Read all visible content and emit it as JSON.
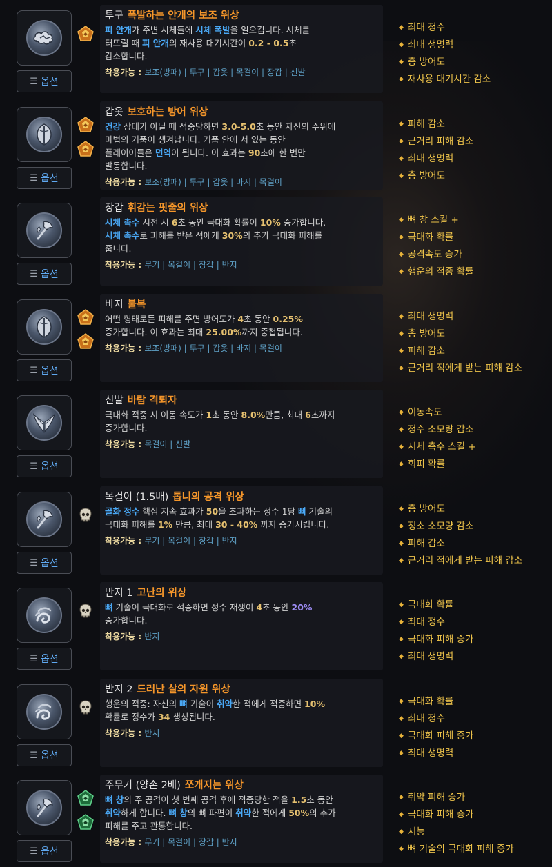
{
  "option_label": "옵션",
  "equip_label": "착용가능 :",
  "colors": {
    "aspect": "#f5962a",
    "keyword": "#4aa8f5",
    "number": "#e6c170",
    "stat": "#ecc24a",
    "option": "#5fa8f0"
  },
  "rows": [
    {
      "slot": "투구",
      "aspect": "폭발하는 안개의 보조 위상",
      "icon": "cloud-burst-icon",
      "badges": [
        "gold-pentagon-icon"
      ],
      "desc": [
        [
          {
            "k": "kw",
            "t": "피 안개"
          },
          {
            "t": "가 주변 시체들에 "
          },
          {
            "k": "kw",
            "t": "시체 폭발"
          },
          {
            "t": "을 일으킵니다. 시체를"
          }
        ],
        [
          {
            "t": "터뜨릴 때 "
          },
          {
            "k": "kw",
            "t": "피 안개"
          },
          {
            "t": "의 재사용 대기시간이 "
          },
          {
            "k": "num",
            "t": "0.2 - 0.5"
          },
          {
            "t": "초"
          }
        ],
        [
          {
            "t": "감소합니다."
          }
        ]
      ],
      "equip": "보조(방패) | 투구 | 갑옷 | 목걸이 | 장갑 | 신발",
      "stats": [
        "최대 정수",
        "최대 생명력",
        "총 방어도",
        "재사용 대기시간 감소"
      ]
    },
    {
      "slot": "갑옷",
      "aspect": "보호하는 방어 위상",
      "icon": "shield-icon",
      "badges": [
        "gold-pentagon-icon",
        "gold-pentagon-icon"
      ],
      "desc": [
        [
          {
            "k": "kw",
            "t": "건강"
          },
          {
            "t": " 상태가 아닐 때 적중당하면 "
          },
          {
            "k": "num",
            "t": "3.0-5.0"
          },
          {
            "t": "초 동안 자신의 주위에"
          }
        ],
        [
          {
            "t": "마법의 거품이 생겨납니다. 거품 안에 서 있는 동안"
          }
        ],
        [
          {
            "t": "플레이어들은 "
          },
          {
            "k": "kw",
            "t": "면역"
          },
          {
            "t": "이 됩니다. 이 효과는 "
          },
          {
            "k": "num",
            "t": "90"
          },
          {
            "t": "초에 한 번만"
          }
        ],
        [
          {
            "t": "발동합니다."
          }
        ]
      ],
      "equip": "보조(방패) | 투구 | 갑옷 | 바지 | 목걸이",
      "stats": [
        "피해 감소",
        "근거리 피해 감소",
        "최대 생명력",
        "총 방어도"
      ]
    },
    {
      "slot": "장갑",
      "aspect": "휘감는 핏줄의 위상",
      "icon": "axe-icon",
      "badges": [],
      "desc": [
        [
          {
            "k": "kw",
            "t": "시체 촉수"
          },
          {
            "t": " 시전 시 "
          },
          {
            "k": "num",
            "t": "6"
          },
          {
            "t": "초 동안 극대화 확률이 "
          },
          {
            "k": "num",
            "t": "10%"
          },
          {
            "t": " 증가합니다."
          }
        ],
        [
          {
            "k": "kw",
            "t": "시체 촉수"
          },
          {
            "t": "로 피해를 받은 적에게 "
          },
          {
            "k": "num",
            "t": "30%"
          },
          {
            "t": "의 추가 극대화 피해를"
          }
        ],
        [
          {
            "t": "줍니다."
          }
        ]
      ],
      "equip": "무기 | 목걸이 | 장갑 | 반지",
      "stats": [
        "뼈 창 스킬 +",
        "극대화 확률",
        "공격속도 증가",
        "행운의 적중 확률"
      ]
    },
    {
      "slot": "바지",
      "aspect": "불복",
      "icon": "shield-icon",
      "badges": [
        "gold-pentagon-icon",
        "gold-pentagon-icon"
      ],
      "desc": [
        [
          {
            "t": "어떤 형태로든 피해를 주면 방어도가 "
          },
          {
            "k": "num",
            "t": "4"
          },
          {
            "t": "초 동안 "
          },
          {
            "k": "num",
            "t": "0.25%"
          }
        ],
        [
          {
            "t": "증가합니다. 이 효과는 최대 "
          },
          {
            "k": "num",
            "t": "25.00%"
          },
          {
            "t": "까지 중첩됩니다."
          }
        ]
      ],
      "equip": "보조(방패) | 투구 | 갑옷 | 바지 | 목걸이",
      "stats": [
        "최대 생명력",
        "총 방어도",
        "피해 감소",
        "근거리 적에게 받는 피해 감소"
      ]
    },
    {
      "slot": "신발",
      "aspect": "바람 격퇴자",
      "icon": "wings-icon",
      "badges": [],
      "desc": [
        [
          {
            "t": "극대화 적중 시 이동 속도가 "
          },
          {
            "k": "num",
            "t": "1"
          },
          {
            "t": "초 동안 "
          },
          {
            "k": "num",
            "t": "8.0%"
          },
          {
            "t": "만큼, 최대 "
          },
          {
            "k": "num",
            "t": "6"
          },
          {
            "t": "초까지"
          }
        ],
        [
          {
            "t": "증가합니다."
          }
        ]
      ],
      "equip": "목걸이 | 신발",
      "stats": [
        "이동속도",
        "정수 소모량 감소",
        "시체 촉수 스킬 +",
        "회피 확률"
      ]
    },
    {
      "slot": "목걸이 (1.5배)",
      "aspect": "톱니의 공격 위상",
      "icon": "axe-icon",
      "badges": [
        "skull-icon"
      ],
      "desc": [
        [
          {
            "k": "kw",
            "t": "골화 정수"
          },
          {
            "t": " 핵심 지속 효과가 "
          },
          {
            "k": "num",
            "t": "50"
          },
          {
            "t": "을 초과하는 정수 1당 "
          },
          {
            "k": "kw",
            "t": "뼈"
          },
          {
            "t": " 기술의"
          }
        ],
        [
          {
            "t": "극대화 피해를 "
          },
          {
            "k": "num",
            "t": "1%"
          },
          {
            "t": " 만큼, 최대 "
          },
          {
            "k": "num",
            "t": "30 - 40%"
          },
          {
            "t": " 까지 증가시킵니다."
          }
        ]
      ],
      "equip": "무기 | 목걸이 | 장갑 | 반지",
      "stats": [
        "총 방어도",
        "정소 소모량 감소",
        "피해 감소",
        "근거리 적에게 받는 피해 감소"
      ]
    },
    {
      "slot": "반지 1",
      "aspect": "고난의 위상",
      "icon": "swirl-icon",
      "badges": [
        "skull-icon"
      ],
      "desc": [
        [
          {
            "k": "kw",
            "t": "뼈"
          },
          {
            "t": " 기술이 극대화로 적중하면 정수 재생이 "
          },
          {
            "k": "num",
            "t": "4"
          },
          {
            "t": "초 동안 "
          },
          {
            "k": "pur",
            "t": "20%"
          }
        ],
        [
          {
            "t": "증가합니다."
          }
        ]
      ],
      "equip": "반지",
      "stats": [
        "극대화 확률",
        "최대 정수",
        "극대화 피해 증가",
        "최대 생명력"
      ]
    },
    {
      "slot": "반지 2",
      "aspect": "드러난 살의 자원 위상",
      "icon": "swirl-icon",
      "badges": [
        "skull-icon"
      ],
      "desc": [
        [
          {
            "t": "행운의 적중: 자신의 "
          },
          {
            "k": "kw",
            "t": "뼈"
          },
          {
            "t": " 기술이 "
          },
          {
            "k": "kw",
            "t": "취약"
          },
          {
            "t": "한 적에게 적중하면 "
          },
          {
            "k": "num",
            "t": "10%"
          }
        ],
        [
          {
            "t": "확률로 정수가 "
          },
          {
            "k": "num",
            "t": "34"
          },
          {
            "t": " 생성됩니다."
          }
        ]
      ],
      "equip": "반지",
      "stats": [
        "극대화 확률",
        "최대 정수",
        "극대화 피해 증가",
        "최대 생명력"
      ]
    },
    {
      "slot": "주무기 (양손 2배)",
      "aspect": "쪼개지는 위상",
      "icon": "axe-icon",
      "badges": [
        "green-pentagon-icon",
        "green-pentagon-icon"
      ],
      "desc": [
        [
          {
            "k": "kw",
            "t": "뼈 창"
          },
          {
            "t": "의 주 공격이 첫 번째 공격 후에 적중당한 적을 "
          },
          {
            "k": "num",
            "t": "1.5"
          },
          {
            "t": "초 동안"
          }
        ],
        [
          {
            "k": "kw",
            "t": "취약"
          },
          {
            "t": "하게 합니다. "
          },
          {
            "k": "kw",
            "t": "뼈 창"
          },
          {
            "t": "의 뼈 파편이 "
          },
          {
            "k": "kw",
            "t": "취약"
          },
          {
            "t": "한 적에게 "
          },
          {
            "k": "num",
            "t": "50%"
          },
          {
            "t": "의 추가"
          }
        ],
        [
          {
            "t": "피해를 주고 관통합니다."
          }
        ]
      ],
      "equip": "무기 | 목걸이 | 장갑 | 반지",
      "stats": [
        "취약 피해 증가",
        "극대화 피해 증가",
        "지능",
        "뼈 기술의 극대화 피해 증가"
      ]
    }
  ]
}
